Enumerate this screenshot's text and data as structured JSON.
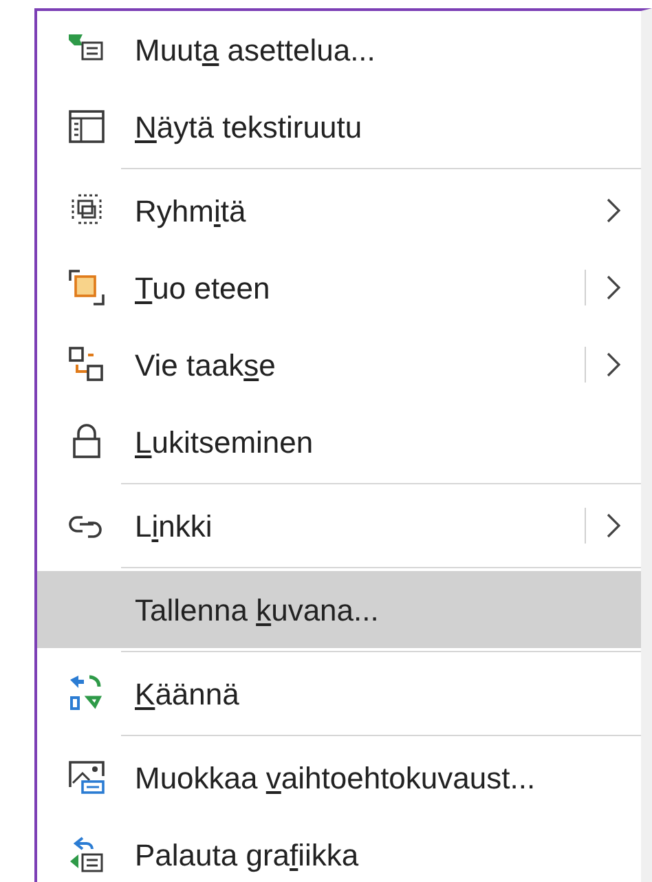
{
  "menu": {
    "items": [
      {
        "label": {
          "before": "Muut",
          "key": "a",
          "after": " asettelua..."
        },
        "selected": false,
        "submenu": false,
        "split": false,
        "separator_after": false
      },
      {
        "label": {
          "key": "N",
          "after": "äytä tekstiruutu"
        },
        "selected": false,
        "submenu": false,
        "split": false,
        "separator_after": true
      },
      {
        "label": {
          "before": "Ryhm",
          "key": "i",
          "after": "tä"
        },
        "selected": false,
        "submenu": true,
        "split": false,
        "separator_after": false
      },
      {
        "label": {
          "key": "T",
          "after": "uo eteen"
        },
        "selected": false,
        "submenu": true,
        "split": true,
        "separator_after": false
      },
      {
        "label": {
          "before": "Vie taak",
          "key": "s",
          "after": "e"
        },
        "selected": false,
        "submenu": true,
        "split": true,
        "separator_after": false
      },
      {
        "label": {
          "key": "L",
          "after": "ukitseminen"
        },
        "selected": false,
        "submenu": false,
        "split": false,
        "separator_after": true
      },
      {
        "label": {
          "before": "L",
          "key": "i",
          "after": "nkki"
        },
        "selected": false,
        "submenu": true,
        "split": true,
        "separator_after": true
      },
      {
        "label": {
          "before": "Tallenna ",
          "key": "k",
          "after": "uvana..."
        },
        "selected": true,
        "submenu": false,
        "split": false,
        "separator_after": true
      },
      {
        "label": {
          "key": "K",
          "after": "äännä"
        },
        "selected": false,
        "submenu": false,
        "split": false,
        "separator_after": true
      },
      {
        "label": {
          "before": "Muokkaa ",
          "key": "v",
          "after": "aihtoehtokuvaust..."
        },
        "selected": false,
        "submenu": false,
        "split": false,
        "separator_after": false
      },
      {
        "label": {
          "before": "Palauta gra",
          "key": "f",
          "after": "iikka"
        },
        "selected": false,
        "submenu": false,
        "split": false,
        "separator_after": false
      }
    ]
  }
}
